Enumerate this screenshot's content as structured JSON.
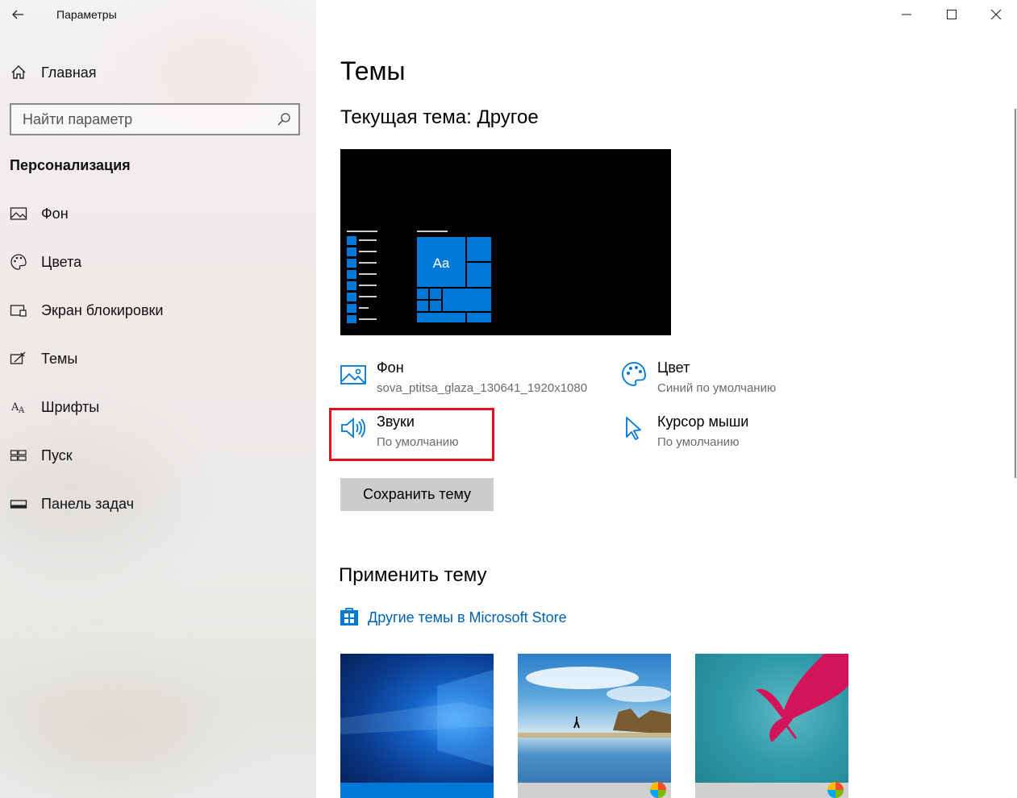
{
  "window": {
    "title": "Параметры",
    "controls": [
      "minimize",
      "maximize",
      "close"
    ]
  },
  "sidebar": {
    "home_label": "Главная",
    "search_placeholder": "Найти параметр",
    "section_title": "Персонализация",
    "items": [
      {
        "label": "Фон",
        "icon": "picture-icon"
      },
      {
        "label": "Цвета",
        "icon": "palette-icon"
      },
      {
        "label": "Экран блокировки",
        "icon": "lock-screen-icon"
      },
      {
        "label": "Темы",
        "icon": "themes-icon"
      },
      {
        "label": "Шрифты",
        "icon": "fonts-icon"
      },
      {
        "label": "Пуск",
        "icon": "start-icon"
      },
      {
        "label": "Панель задач",
        "icon": "taskbar-icon"
      }
    ]
  },
  "main": {
    "title": "Темы",
    "current_theme": "Текущая тема: Другое",
    "preview_tile_label": "Aa",
    "properties": {
      "background": {
        "title": "Фон",
        "value": "sova_ptitsa_glaza_130641_1920x1080"
      },
      "color": {
        "title": "Цвет",
        "value": "Синий по умолчанию"
      },
      "sounds": {
        "title": "Звуки",
        "value": "По умолчанию"
      },
      "cursor": {
        "title": "Курсор мыши",
        "value": "По умолчанию"
      }
    },
    "save_button": "Сохранить тему",
    "apply_heading": "Применить тему",
    "store_link": "Другие темы в Microsoft Store",
    "themes": [
      {
        "name": "windows",
        "accent": "#0078d7"
      },
      {
        "name": "windows-10",
        "accent": "#d0d0d0"
      },
      {
        "name": "flowers",
        "accent": "#d0d0d0"
      }
    ]
  },
  "colors": {
    "accent": "#0078d7",
    "link": "#0063b1",
    "highlight": "#e8101a"
  }
}
